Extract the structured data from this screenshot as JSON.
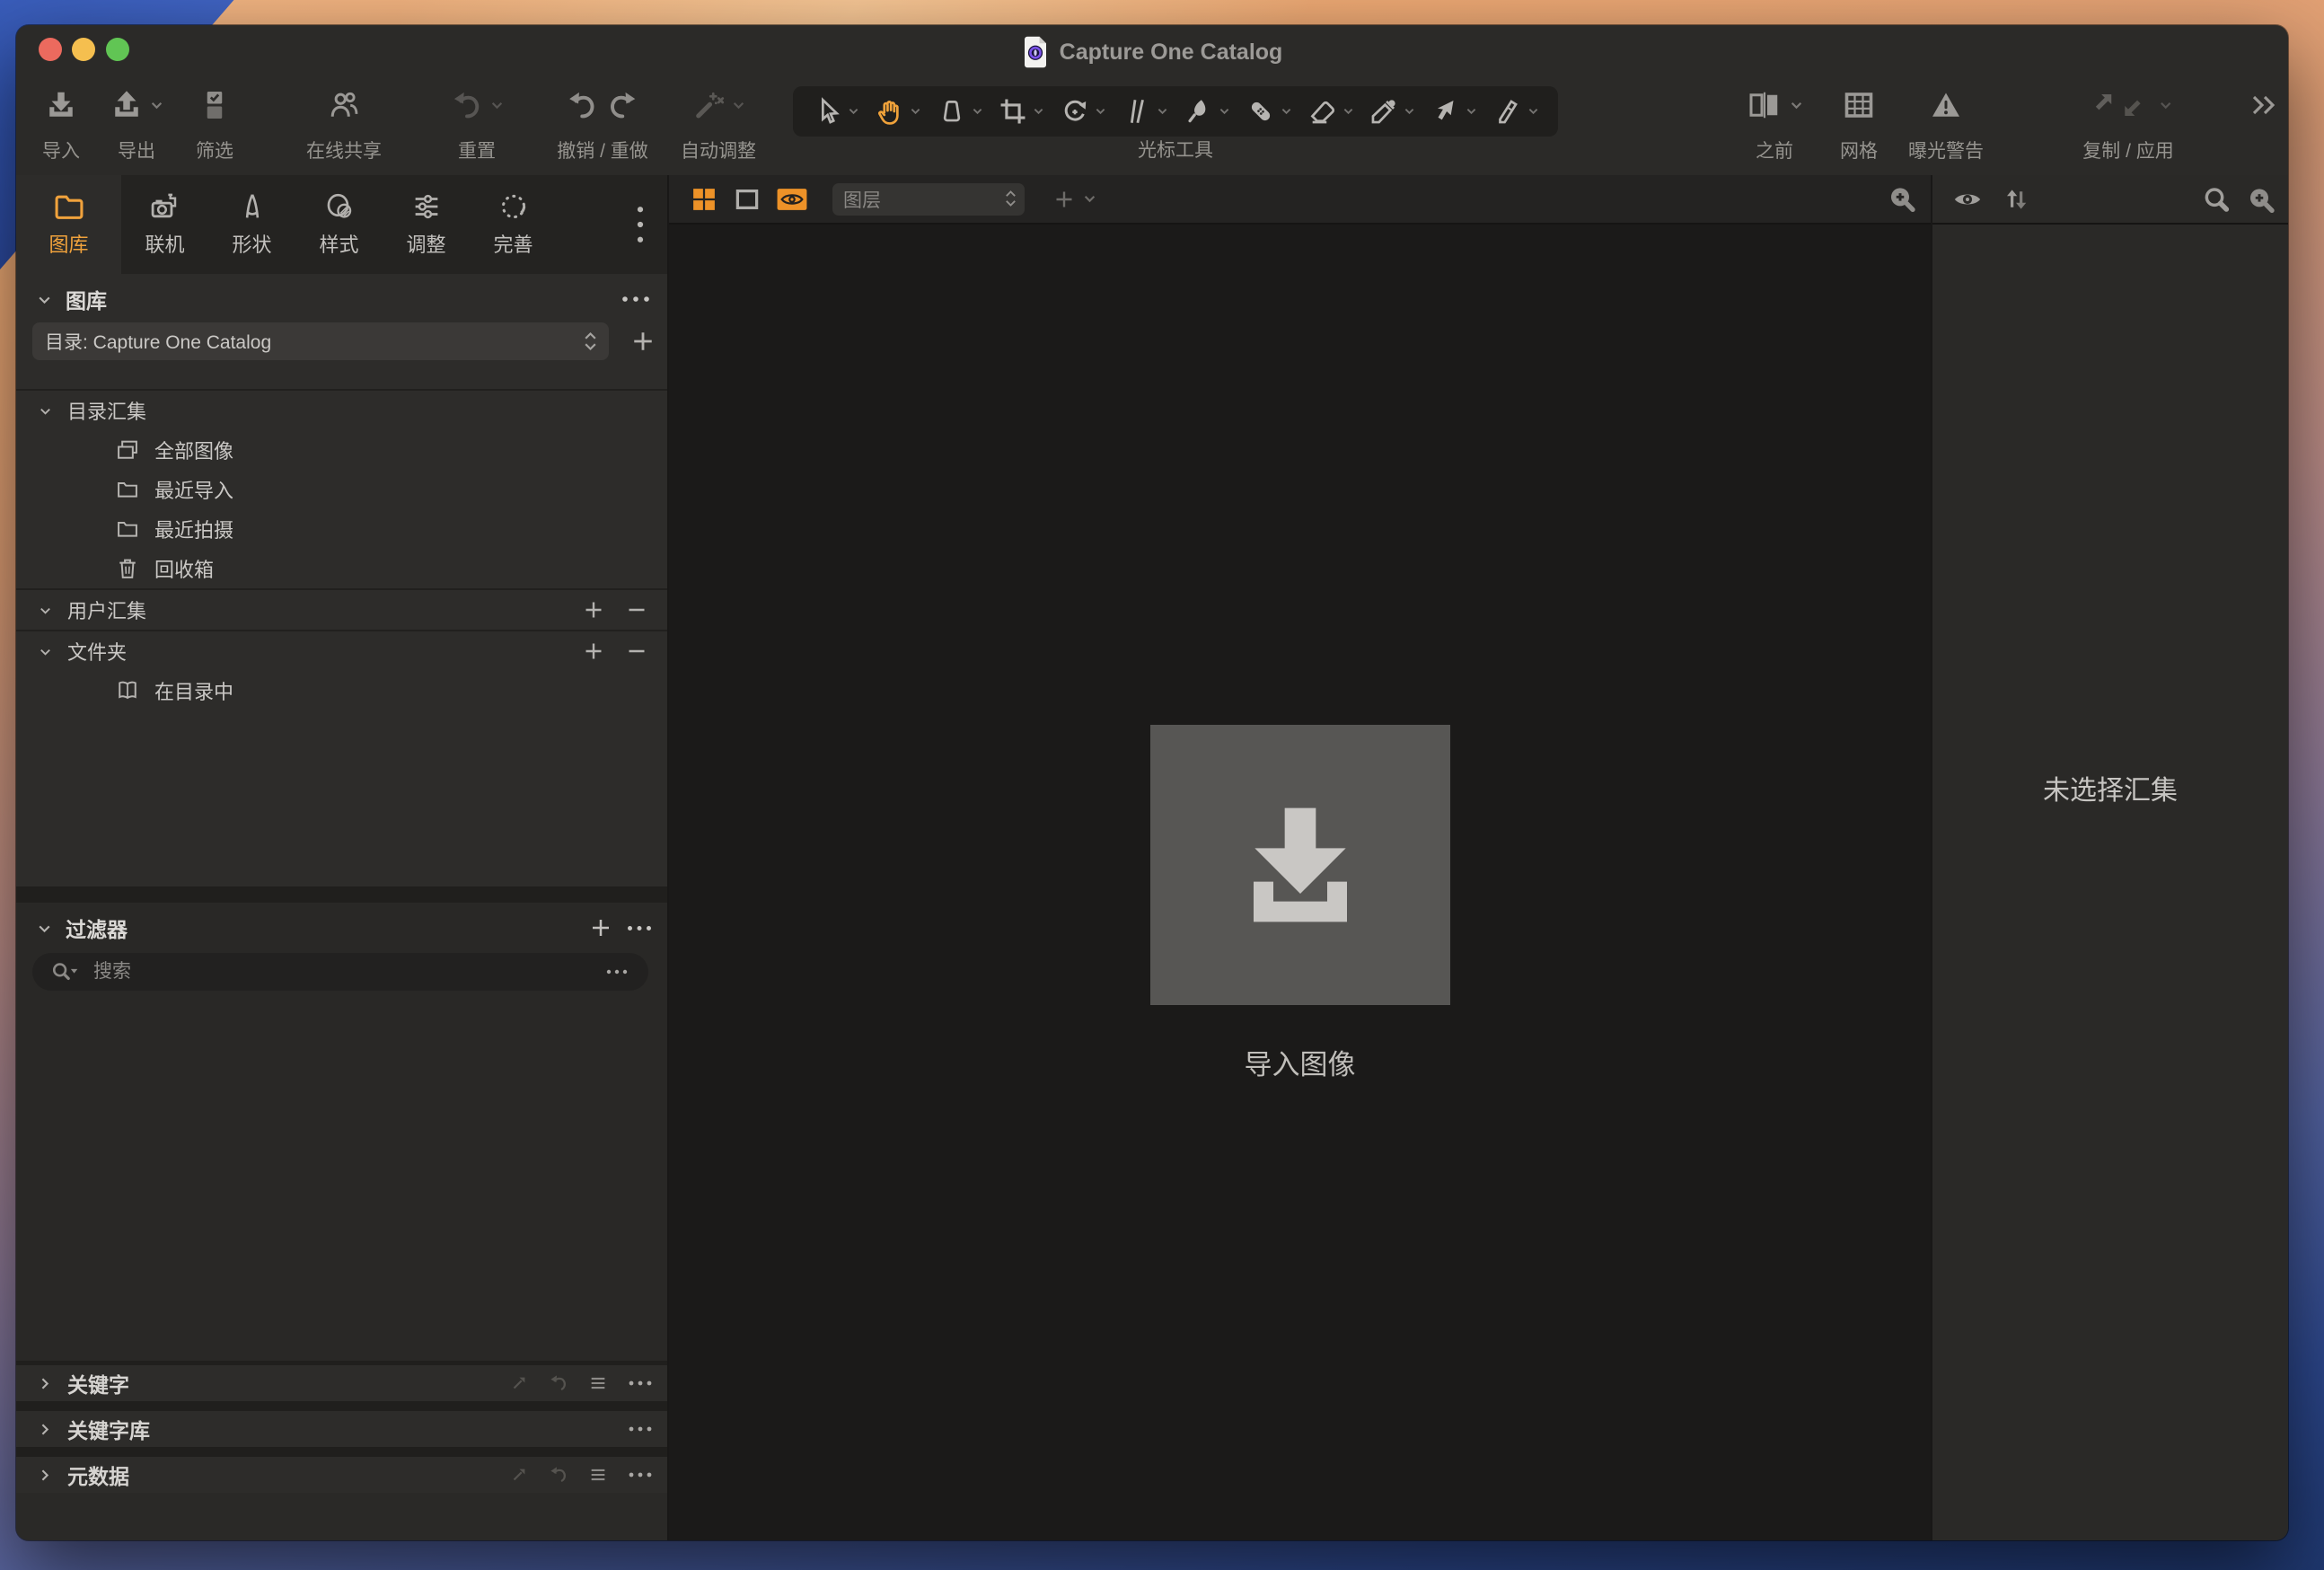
{
  "window": {
    "title": "Capture One Catalog"
  },
  "toolbar": {
    "import": "导入",
    "export": "导出",
    "filter": "筛选",
    "share": "在线共享",
    "reset": "重置",
    "undo_redo": "撤销 / 重做",
    "auto_adjust": "自动调整",
    "cursor_tools": "光标工具",
    "before": "之前",
    "grid": "网格",
    "exposure_warning": "曝光警告",
    "copy_apply": "复制 / 应用"
  },
  "sidebar": {
    "tabs": [
      {
        "label": "图库",
        "active": true
      },
      {
        "label": "联机"
      },
      {
        "label": "形状"
      },
      {
        "label": "样式"
      },
      {
        "label": "调整"
      },
      {
        "label": "完善"
      }
    ],
    "library": {
      "header": "图库",
      "catalog_selector": "目录: Capture One Catalog",
      "catalog_collections": {
        "label": "目录汇集",
        "items": [
          "全部图像",
          "最近导入",
          "最近拍摄",
          "回收箱"
        ]
      },
      "user_collections": {
        "label": "用户汇集"
      },
      "folders": {
        "label": "文件夹",
        "items": [
          "在目录中"
        ]
      }
    },
    "filters": {
      "header": "过滤器",
      "search_placeholder": "搜索"
    },
    "keywords": {
      "label": "关键字"
    },
    "keyword_library": {
      "label": "关键字库"
    },
    "metadata": {
      "label": "元数据"
    }
  },
  "viewer": {
    "layers_selector": "图层",
    "import_prompt": "导入图像"
  },
  "browser": {
    "empty_message": "未选择汇集"
  },
  "colors": {
    "accent_orange": "#ee9b2d",
    "window_bg": "#2b2a28",
    "viewer_bg": "#1b1a19",
    "traffic_red": "#ec6a5e",
    "traffic_yellow": "#f5bf4f",
    "traffic_green": "#61c554"
  }
}
